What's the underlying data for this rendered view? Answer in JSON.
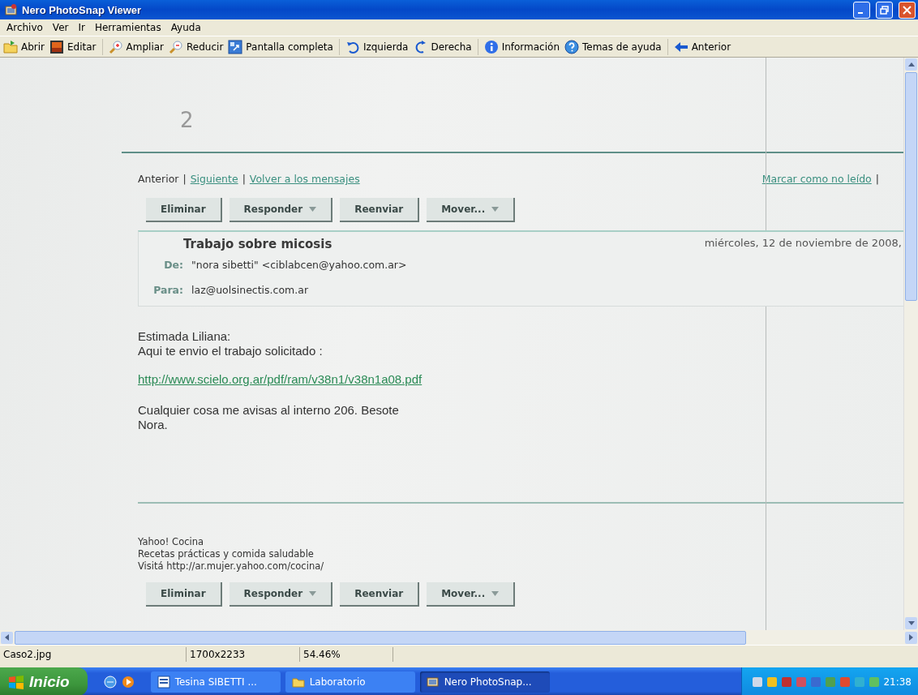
{
  "window": {
    "title": "Nero PhotoSnap Viewer"
  },
  "menu": [
    "Archivo",
    "Ver",
    "Ir",
    "Herramientas",
    "Ayuda"
  ],
  "toolbar": [
    [
      "Abrir",
      "Editar"
    ],
    [
      "Ampliar",
      "Reducir",
      "Pantalla completa"
    ],
    [
      "Izquierda",
      "Derecha"
    ],
    [
      "Información",
      "Temas de ayuda"
    ],
    [
      "Anterior"
    ]
  ],
  "document": {
    "handwritten_mark": "2",
    "nav": [
      {
        "label": "Anterior",
        "kind": "text"
      },
      {
        "label": "|",
        "kind": "separator"
      },
      {
        "label": "Siguiente",
        "kind": "link"
      },
      {
        "label": "|",
        "kind": "separator"
      },
      {
        "label": "Volver a los mensajes",
        "kind": "link"
      }
    ],
    "nav_right": [
      {
        "label": "Marcar como no leído",
        "kind": "link"
      },
      {
        "label": "|",
        "kind": "separator"
      }
    ],
    "top_buttons": [
      {
        "label": "Eliminar",
        "dropdown": false
      },
      {
        "label": "Responder",
        "dropdown": true
      },
      {
        "label": "Reenviar",
        "dropdown": false
      },
      {
        "label": "Mover...",
        "dropdown": true
      }
    ],
    "message": {
      "subject": "Trabajo sobre micosis",
      "date": "miércoles, 12 de noviembre de 2008,",
      "from_label": "De:",
      "from": "\"nora sibetti\" <ciblabcen@yahoo.com.ar>",
      "to_label": "Para:",
      "to": "laz@uolsinectis.com.ar"
    },
    "body": {
      "greeting": [
        "Estimada Liliana:",
        "Aqui te envio el trabajo solicitado :"
      ],
      "link": "http://www.scielo.org.ar/pdf/ram/v38n1/v38n1a08.pdf",
      "closing": [
        "Cualquier cosa me avisas al interno 206. Besote",
        "Nora."
      ]
    },
    "footer": [
      "Yahoo! Cocina",
      "Recetas prácticas y comida saludable",
      "Visitá http://ar.mujer.yahoo.com/cocina/"
    ],
    "bottom_buttons": [
      {
        "label": "Eliminar",
        "dropdown": false
      },
      {
        "label": "Responder",
        "dropdown": true
      },
      {
        "label": "Reenviar",
        "dropdown": false
      },
      {
        "label": "Mover...",
        "dropdown": true
      }
    ]
  },
  "status_bar": [
    "Caso2.jpg",
    "1700x2233",
    "54.46%"
  ],
  "taskbar": {
    "start": "Inicio",
    "tasks": [
      {
        "label": "Tesina SIBETTI ...",
        "selected": false
      },
      {
        "label": "Laboratorio",
        "selected": false
      },
      {
        "label": "Nero PhotoSnap...",
        "selected": true
      }
    ],
    "clock": "21:38"
  }
}
